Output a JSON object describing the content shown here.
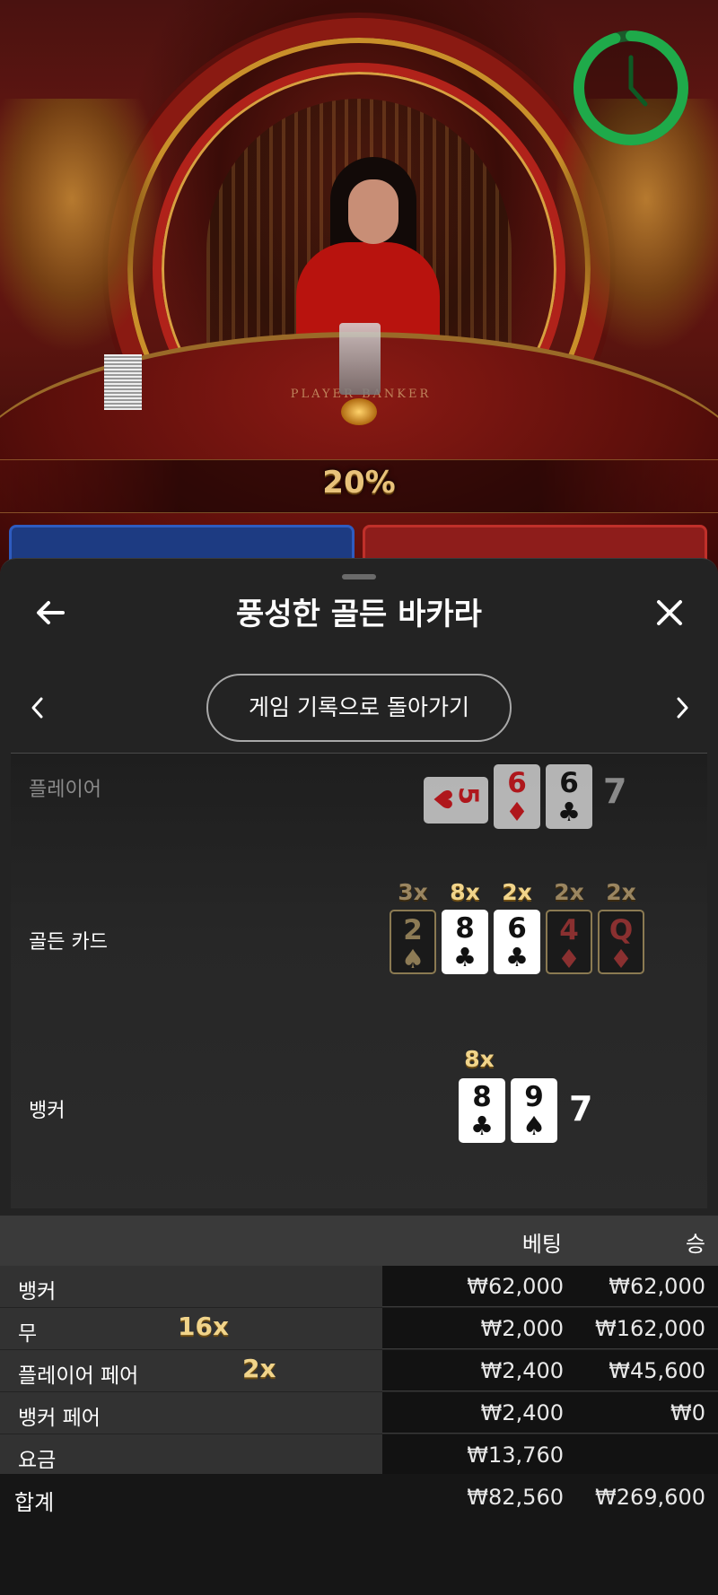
{
  "stage": {
    "table_text": "PLAYER      BANKER",
    "percentage": "20%",
    "timer_fraction": 0.95
  },
  "sheet": {
    "title": "풍성한 골든 바카라",
    "back_icon": "arrow-left-icon",
    "close_icon": "close-icon",
    "history_button": "게임 기록으로 돌아가기",
    "rows": {
      "player": {
        "label": "플레이어",
        "cards": [
          {
            "rank": "5",
            "suit": "♥",
            "sideways": true
          },
          {
            "rank": "6",
            "suit": "♦"
          },
          {
            "rank": "6",
            "suit": "♣"
          }
        ],
        "total": "7"
      },
      "golden": {
        "label": "골든 카드",
        "cards": [
          {
            "rank": "2",
            "suit": "♠",
            "mult": "3x"
          },
          {
            "rank": "8",
            "suit": "♣",
            "mult": "8x"
          },
          {
            "rank": "6",
            "suit": "♣",
            "mult": "2x"
          },
          {
            "rank": "4",
            "suit": "♦",
            "mult": "2x"
          },
          {
            "rank": "Q",
            "suit": "♦",
            "mult": "2x"
          }
        ]
      },
      "banker": {
        "label": "뱅커",
        "mult": "8x",
        "cards": [
          {
            "rank": "8",
            "suit": "♣"
          },
          {
            "rank": "9",
            "suit": "♠"
          }
        ],
        "total": "7"
      }
    }
  },
  "bets": {
    "header": {
      "bet": "베팅",
      "win": "승"
    },
    "rows": [
      {
        "name": "뱅커",
        "mult": "",
        "bet": "₩62,000",
        "win": "₩62,000"
      },
      {
        "name": "무",
        "mult": "16x",
        "bet": "₩2,000",
        "win": "₩162,000"
      },
      {
        "name": "플레이어 페어",
        "mult": "2x",
        "bet": "₩2,400",
        "win": "₩45,600"
      },
      {
        "name": "뱅커 페어",
        "mult": "",
        "bet": "₩2,400",
        "win": "₩0"
      },
      {
        "name": "요금",
        "mult": "",
        "bet": "₩13,760",
        "win": ""
      }
    ],
    "total": {
      "name": "합계",
      "bet": "₩82,560",
      "win": "₩269,600"
    }
  },
  "colors": {
    "gold": "#f1d48a",
    "timer_green": "#1faa4a",
    "player_blue": "#1d3b82",
    "banker_red": "#8e1d1b"
  }
}
